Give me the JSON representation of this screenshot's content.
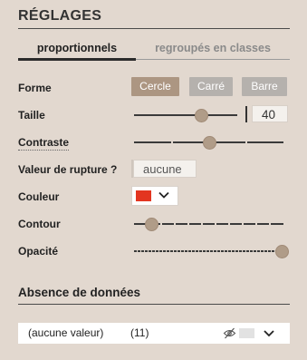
{
  "panel": {
    "title": "RÉGLAGES"
  },
  "tabs": [
    {
      "label": "proportionnels",
      "active": true
    },
    {
      "label": "regroupés en classes",
      "active": false
    }
  ],
  "forme": {
    "label": "Forme",
    "options": [
      {
        "label": "Cercle",
        "selected": true
      },
      {
        "label": "Carré",
        "selected": false
      },
      {
        "label": "Barre",
        "selected": false
      }
    ]
  },
  "taille": {
    "label": "Taille",
    "value": "40",
    "slider_fraction": 0.58
  },
  "contraste": {
    "label": "Contraste",
    "slider_fraction": 0.5
  },
  "rupture": {
    "label": "Valeur de rupture ?",
    "value": "aucune"
  },
  "couleur": {
    "label": "Couleur",
    "color": "#e33520"
  },
  "contour": {
    "label": "Contour",
    "slider_fraction": 0.1
  },
  "opacite": {
    "label": "Opacité",
    "slider_fraction": 1.0
  },
  "absence": {
    "title": "Absence de données",
    "row_label": "(aucune valeur)",
    "row_count": "(11)",
    "icon": "eye-slash-icon"
  },
  "colors": {
    "background": "#e2d8cf",
    "active_button": "#ac9682",
    "button": "#b5b1ad",
    "thumb": "#b09c88"
  }
}
